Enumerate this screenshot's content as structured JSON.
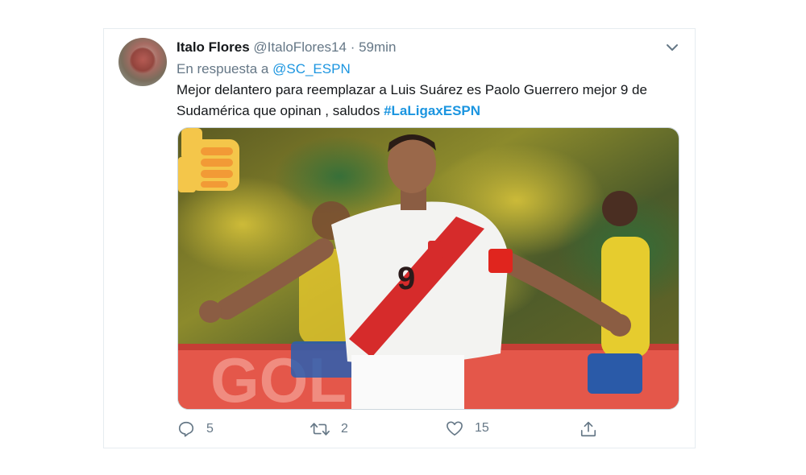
{
  "tweet": {
    "author_name": "Italo Flores",
    "author_handle": "@ItaloFlores14",
    "separator": "·",
    "time": "59min",
    "reply_prefix": "En respuesta a",
    "reply_to": "@SC_ESPN",
    "text_main": "Mejor delantero para reemplazar a Luis Suárez es Paolo Guerrero mejor 9 de Sudamérica que opinan , saludos ",
    "hashtag": "#LaLigaxESPN",
    "media": {
      "jersey_number": "9",
      "banner_text": "GOL",
      "thumb_emoji_icon": "thumbs-up-icon"
    },
    "actions": {
      "reply_count": "5",
      "retweet_count": "2",
      "like_count": "15"
    }
  },
  "icons": {
    "more": "chevron-down-icon",
    "reply": "reply-icon",
    "retweet": "retweet-icon",
    "like": "heart-icon",
    "share": "share-icon"
  },
  "colors": {
    "link": "#1b95e0",
    "muted": "#657786",
    "text": "#14171a",
    "border": "#e6ecf0"
  }
}
